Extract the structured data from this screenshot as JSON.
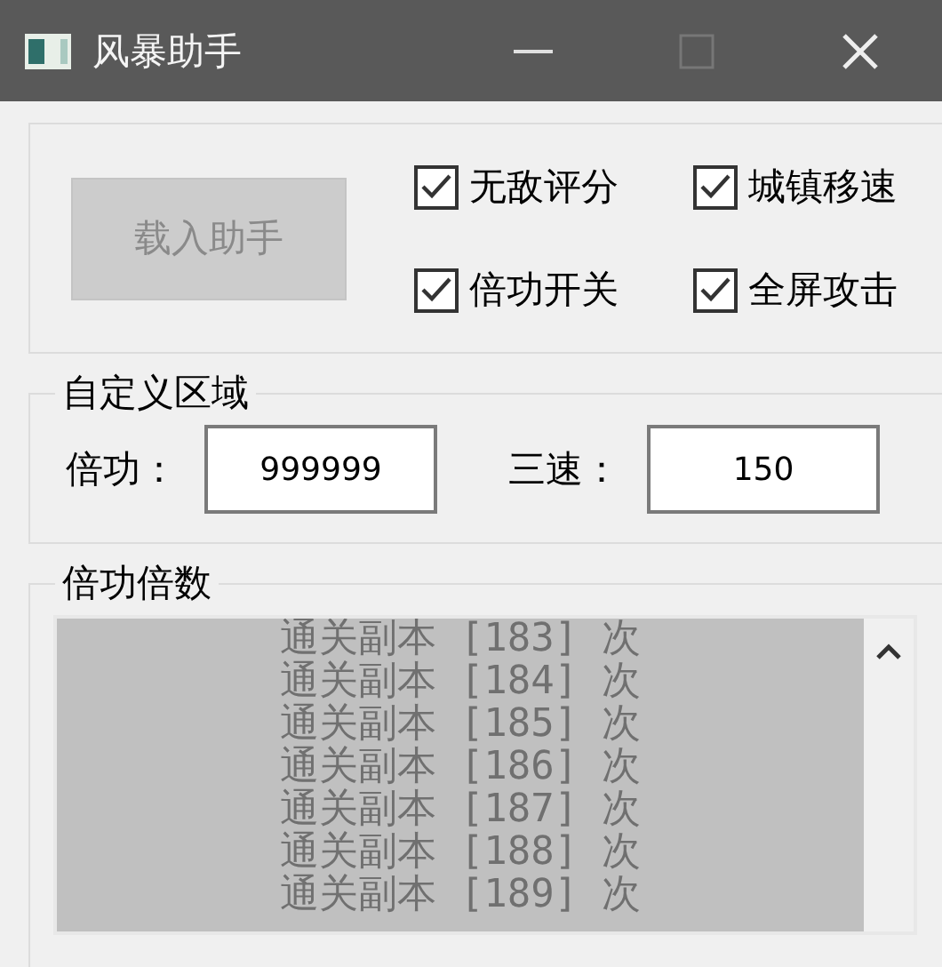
{
  "window": {
    "title": "风暴助手"
  },
  "load_button": {
    "label": "载入助手",
    "disabled": true
  },
  "options": [
    {
      "label": "无敌评分",
      "checked": true
    },
    {
      "label": "城镇移速",
      "checked": true
    },
    {
      "label": "倍功开关",
      "checked": true
    },
    {
      "label": "全屏攻击",
      "checked": true
    }
  ],
  "custom_group": {
    "title": "自定义区域",
    "fields": [
      {
        "label": "倍功：",
        "value": "999999"
      },
      {
        "label": "三速：",
        "value": "150"
      }
    ]
  },
  "multiplier_group": {
    "title": "倍功倍数",
    "disabled": true,
    "items": [
      "通关副本 [183] 次",
      "通关副本 [184] 次",
      "通关副本 [185] 次",
      "通关副本 [186] 次",
      "通关副本 [187] 次",
      "通关副本 [188] 次",
      "通关副本 [189] 次"
    ]
  }
}
